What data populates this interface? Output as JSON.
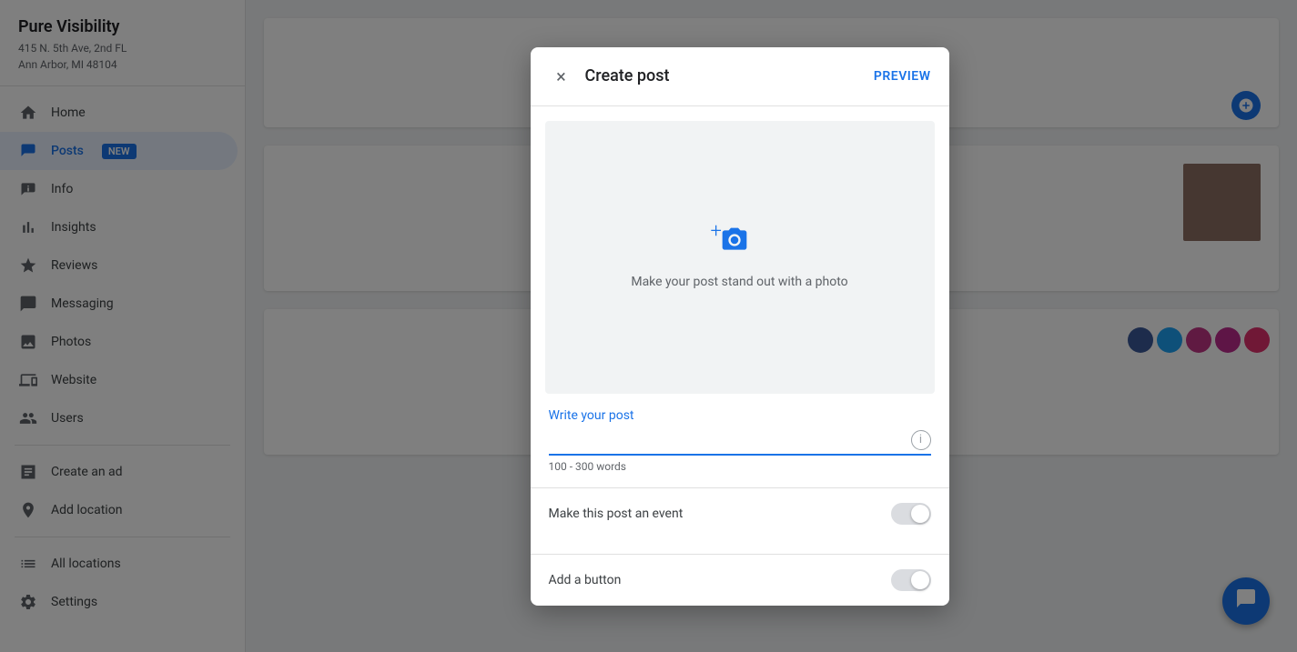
{
  "app": {
    "business_name": "Pure Visibility",
    "address_line1": "415 N. 5th Ave, 2nd FL",
    "address_line2": "Ann Arbor, MI 48104"
  },
  "sidebar": {
    "items": [
      {
        "id": "home",
        "label": "Home",
        "icon": "home-icon"
      },
      {
        "id": "posts",
        "label": "Posts",
        "icon": "posts-icon",
        "badge": "NEW",
        "active": true
      },
      {
        "id": "info",
        "label": "Info",
        "icon": "info-icon"
      },
      {
        "id": "insights",
        "label": "Insights",
        "icon": "insights-icon"
      },
      {
        "id": "reviews",
        "label": "Reviews",
        "icon": "reviews-icon"
      },
      {
        "id": "messaging",
        "label": "Messaging",
        "icon": "messaging-icon"
      },
      {
        "id": "photos",
        "label": "Photos",
        "icon": "photos-icon"
      },
      {
        "id": "website",
        "label": "Website",
        "icon": "website-icon"
      },
      {
        "id": "users",
        "label": "Users",
        "icon": "users-icon"
      },
      {
        "id": "create-ad",
        "label": "Create an ad",
        "icon": "ad-icon"
      },
      {
        "id": "add-location",
        "label": "Add location",
        "icon": "location-icon"
      },
      {
        "id": "all-locations",
        "label": "All locations",
        "icon": "all-locations-icon"
      },
      {
        "id": "settings",
        "label": "Settings",
        "icon": "settings-icon"
      }
    ]
  },
  "modal": {
    "title": "Create post",
    "preview_label": "PREVIEW",
    "close_icon": "×",
    "photo_area": {
      "prompt": "Make your post stand out with a photo"
    },
    "post_text": {
      "label": "Write your post",
      "placeholder": "",
      "word_hint": "100 - 300 words"
    },
    "event_toggle": {
      "label": "Make this post an event",
      "enabled": false
    },
    "button_toggle": {
      "label": "Add a button",
      "enabled": false
    }
  },
  "colors": {
    "blue": "#1a73e8",
    "text_primary": "#202124",
    "text_secondary": "#5f6368",
    "divider": "#e0e0e0",
    "active_bg": "#e8f0fe",
    "toggle_off": "#dadce0"
  }
}
